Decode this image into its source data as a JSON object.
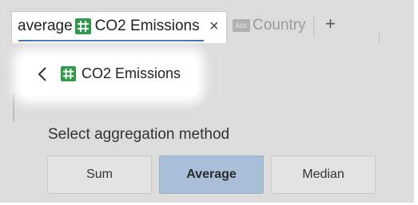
{
  "tabs": {
    "active": {
      "aggregation": "average",
      "field_icon": "measure-icon",
      "field_name": "CO2 Emissions",
      "close_label": "×"
    },
    "inactive": {
      "field_icon": "Abc",
      "field_name": "Country"
    },
    "add_label": "+"
  },
  "panel": {
    "back_icon": "chevron-left-icon",
    "field_icon": "measure-icon",
    "field_name": "CO2 Emissions",
    "aggregation_prompt": "Select aggregation method",
    "options": [
      {
        "label": "Sum",
        "selected": false
      },
      {
        "label": "Average",
        "selected": true
      },
      {
        "label": "Median",
        "selected": false
      }
    ]
  },
  "colors": {
    "accent_underline": "#3f6fb4",
    "measure_green": "#2e9a4a",
    "selected_button": "#a9bfd8",
    "panel_background": "#dcdcdc"
  }
}
